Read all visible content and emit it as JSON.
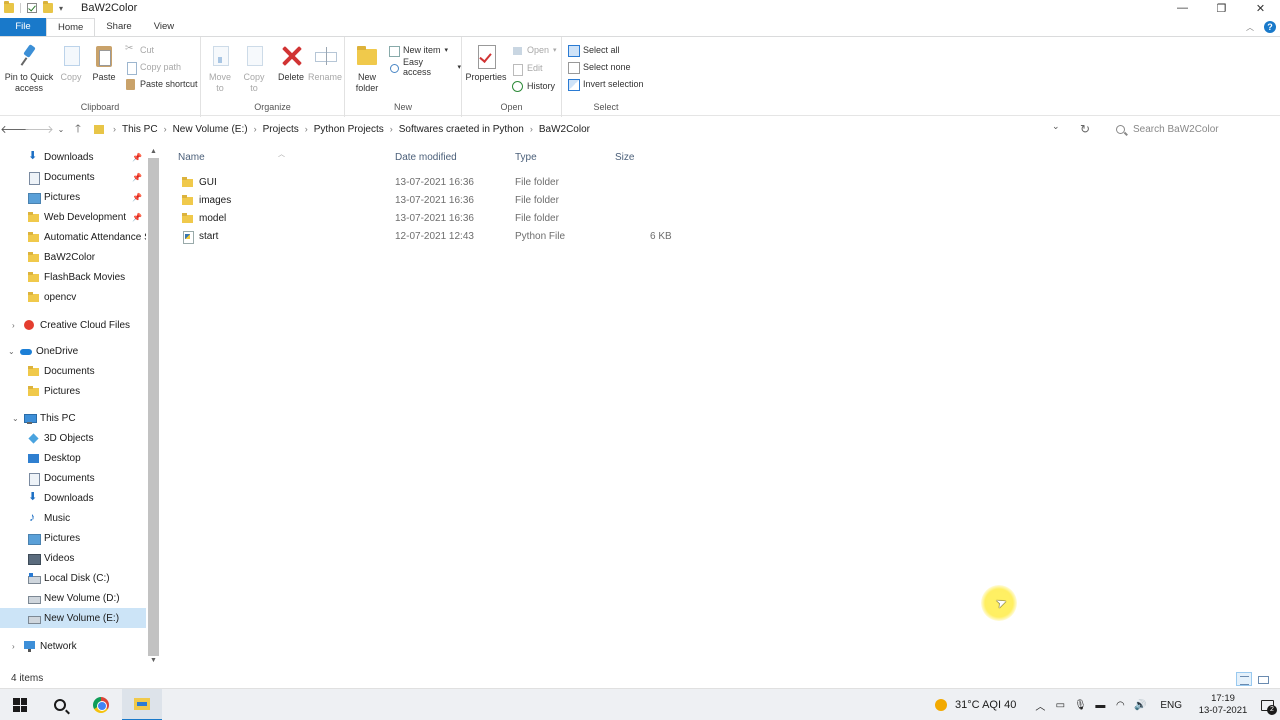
{
  "window": {
    "title": "BaW2Color",
    "controls": {
      "minimize": "—",
      "restore": "❐",
      "close": "✕"
    }
  },
  "ribbon_tabs": [
    {
      "label": "File"
    },
    {
      "label": "Home"
    },
    {
      "label": "Share"
    },
    {
      "label": "View"
    }
  ],
  "ribbon": {
    "clipboard": {
      "label": "Clipboard",
      "pin_to_quick_access": "Pin to Quick access",
      "copy": "Copy",
      "paste": "Paste",
      "cut": "Cut",
      "copy_path": "Copy path",
      "paste_shortcut": "Paste shortcut"
    },
    "organize": {
      "label": "Organize",
      "move_to": "Move to",
      "copy_to": "Copy to",
      "delete": "Delete",
      "rename": "Rename"
    },
    "new": {
      "label": "New",
      "new_folder": "New folder",
      "new_item": "New item",
      "easy_access": "Easy access"
    },
    "open": {
      "label": "Open",
      "properties": "Properties",
      "open": "Open",
      "edit": "Edit",
      "history": "History"
    },
    "select": {
      "label": "Select",
      "select_all": "Select all",
      "select_none": "Select none",
      "invert_selection": "Invert selection"
    }
  },
  "address": {
    "crumbs": [
      "This PC",
      "New Volume (E:)",
      "Projects",
      "Python Projects",
      "Softwares craeted in Python",
      "BaW2Color"
    ],
    "search_placeholder": "Search BaW2Color"
  },
  "nav": {
    "quick_access": [
      {
        "label": "Downloads",
        "icon": "download-icon",
        "pinned": true
      },
      {
        "label": "Documents",
        "icon": "documents-icon",
        "pinned": true
      },
      {
        "label": "Pictures",
        "icon": "pictures-icon",
        "pinned": true
      },
      {
        "label": "Web Development",
        "icon": "folder-icon",
        "pinned": true
      },
      {
        "label": "Automatic Attendance S",
        "icon": "folder-icon",
        "pinned": false
      },
      {
        "label": "BaW2Color",
        "icon": "folder-icon",
        "pinned": false
      },
      {
        "label": "FlashBack Movies",
        "icon": "folder-icon",
        "pinned": false
      },
      {
        "label": "opencv",
        "icon": "folder-icon",
        "pinned": false
      }
    ],
    "creative_cloud": "Creative Cloud Files",
    "onedrive": "OneDrive",
    "onedrive_items": [
      "Documents",
      "Pictures"
    ],
    "this_pc": "This PC",
    "this_pc_items": [
      {
        "label": "3D Objects",
        "icon": "3d-objects-icon"
      },
      {
        "label": "Desktop",
        "icon": "desktop-icon"
      },
      {
        "label": "Documents",
        "icon": "documents-icon"
      },
      {
        "label": "Downloads",
        "icon": "download-icon"
      },
      {
        "label": "Music",
        "icon": "music-icon"
      },
      {
        "label": "Pictures",
        "icon": "pictures-icon"
      },
      {
        "label": "Videos",
        "icon": "videos-icon"
      },
      {
        "label": "Local Disk (C:)",
        "icon": "drive-c-icon"
      },
      {
        "label": "New Volume (D:)",
        "icon": "drive-icon"
      },
      {
        "label": "New Volume (E:)",
        "icon": "drive-icon",
        "selected": true
      }
    ],
    "network": "Network"
  },
  "columns": {
    "name": "Name",
    "date_modified": "Date modified",
    "type": "Type",
    "size": "Size"
  },
  "files": [
    {
      "name": "GUI",
      "date": "13-07-2021 16:36",
      "type": "File folder",
      "size": "",
      "icon": "folder-icon"
    },
    {
      "name": "images",
      "date": "13-07-2021 16:36",
      "type": "File folder",
      "size": "",
      "icon": "folder-icon"
    },
    {
      "name": "model",
      "date": "13-07-2021 16:36",
      "type": "File folder",
      "size": "",
      "icon": "folder-icon"
    },
    {
      "name": "start",
      "date": "12-07-2021 12:43",
      "type": "Python File",
      "size": "6 KB",
      "icon": "python-file-icon"
    }
  ],
  "status": {
    "item_count": "4 items"
  },
  "taskbar": {
    "weather": "31°C  AQI 40",
    "lang": "ENG",
    "time": "17:19",
    "date": "13-07-2021",
    "notifications": "2"
  }
}
